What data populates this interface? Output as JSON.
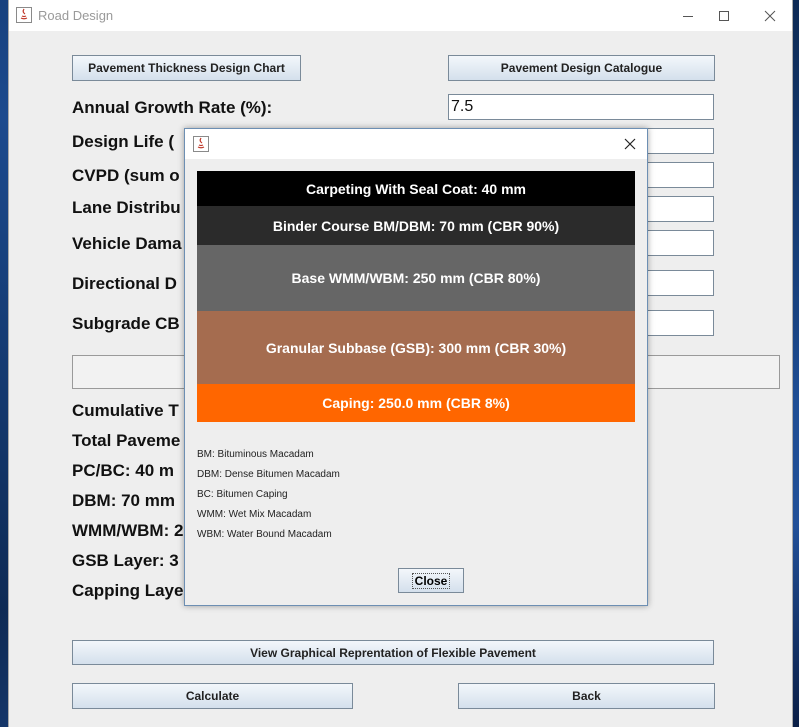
{
  "window": {
    "title": "Road Design"
  },
  "buttons": {
    "thickness_chart": "Pavement Thickness Design Chart",
    "design_catalogue": "Pavement Design Catalogue",
    "view_graphical": "View Graphical Reprentation of Flexible Pavement",
    "calculate": "Calculate",
    "back": "Back"
  },
  "form": {
    "growth_label": "Annual Growth Rate (%):",
    "growth_value": "7.5",
    "design_life_label": "Design Life (",
    "cvpd_label": "CVPD (sum o",
    "lane_label": "Lane Distribu",
    "vdf_label": "Vehicle Dama",
    "directional_label": "Directional D",
    "subgrade_label": "Subgrade CB"
  },
  "results": {
    "cumulative": "Cumulative T",
    "total": "Total Paveme",
    "pcbc": "PC/BC: 40 m",
    "dbm": "DBM: 70 mm",
    "wmm": "WMM/WBM: 2",
    "gsb": "GSB Layer: 3",
    "capping": "Capping Laye"
  },
  "dialog": {
    "layers": [
      {
        "label": "Carpeting With Seal Coat: 40 mm",
        "color": "#000000"
      },
      {
        "label": "Binder Course BM/DBM: 70 mm (CBR 90%)",
        "color": "#2b2b2b"
      },
      {
        "label": "Base WMM/WBM: 250 mm (CBR 80%)",
        "color": "#666666"
      },
      {
        "label": "Granular Subbase (GSB): 300 mm (CBR 30%)",
        "color": "#a56c4f"
      },
      {
        "label": "Caping: 250.0 mm (CBR 8%)",
        "color": "#ff6600"
      }
    ],
    "legend": [
      "BM: Bituminous Macadam",
      "DBM: Dense Bitumen Macadam",
      "BC: Bitumen Caping",
      "WMM: Wet Mix Macadam",
      "WBM: Water Bound Macadam"
    ],
    "close_label": "Close"
  }
}
